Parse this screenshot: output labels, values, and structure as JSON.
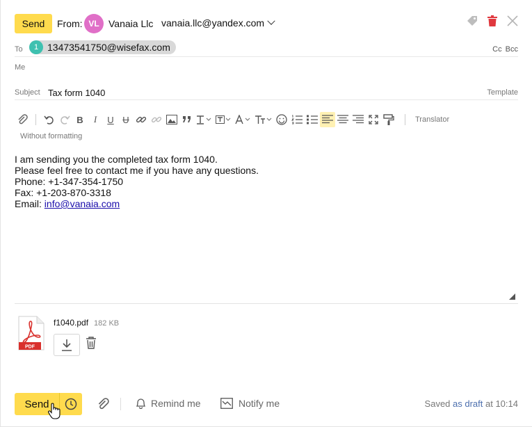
{
  "header": {
    "send_label": "Send",
    "from_label": "From:",
    "avatar_initials": "VL",
    "avatar_color": "#e06fc7",
    "from_name": "Vanaia Llc",
    "from_email": "vanaia.llc@yandex.com",
    "icons": [
      "tag-icon",
      "trash-icon",
      "close-icon"
    ]
  },
  "to": {
    "label": "To",
    "recipient_number": "1",
    "recipient": "13473541750@wisefax.com",
    "cc_bcc": "Cc Bcc"
  },
  "me": {
    "label": "Me"
  },
  "subject": {
    "label": "Subject",
    "value": "Tax form 1040",
    "template_label": "Template"
  },
  "toolbar": {
    "translator": "Translator",
    "without_formatting": "Without formatting",
    "bold": "B",
    "italic": "I",
    "underline": "U",
    "strike": "U"
  },
  "body": {
    "line1": "I am sending you the completed tax form 1040.",
    "line2": "Please feel free to contact me if you have any questions.",
    "line3": "Phone: +1-347-354-1750",
    "line4": "Fax: +1-203-870-3318",
    "line5_prefix": "Email: ",
    "email_link": "info@vanaia.com"
  },
  "attachment": {
    "name": "f1040.pdf",
    "size": "182 KB",
    "badge": "PDF"
  },
  "footer": {
    "send_label": "Send",
    "remind_label": "Remind me",
    "notify_label": "Notify me",
    "saved_prefix": "Saved ",
    "saved_draft": "as draft",
    "saved_time": " at 10:14"
  },
  "colors": {
    "accent": "#ffdb4d",
    "chip": "#d9d9d9",
    "chip_badge": "#3fc1b0",
    "trash": "#e0383e",
    "pdf": "#d9302c",
    "link": "#1a0dab"
  }
}
